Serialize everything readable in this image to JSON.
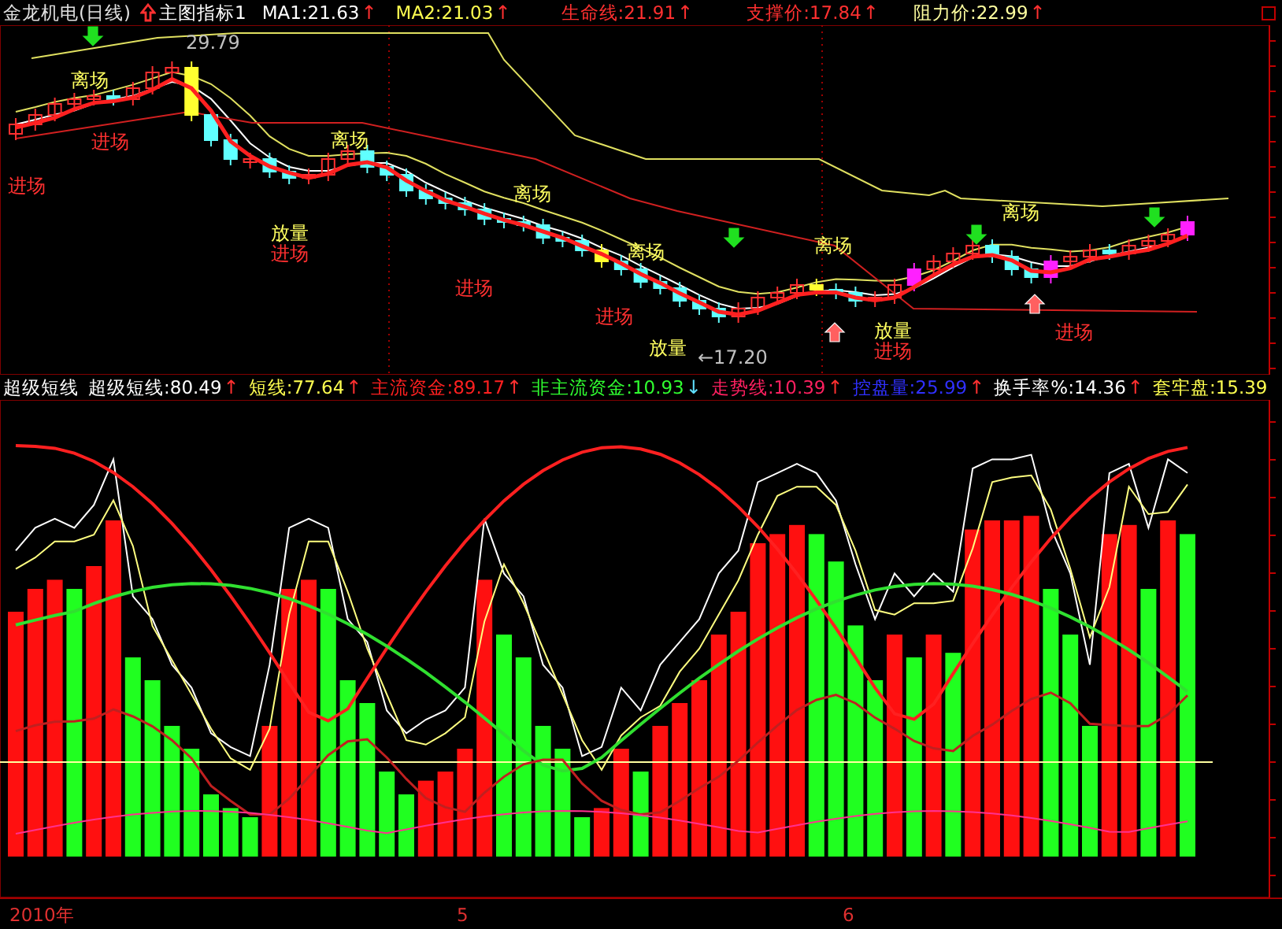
{
  "title_bar": {
    "stock": "金龙机电(日线)",
    "indicator": "主图指标1",
    "readings": [
      {
        "label": "MA1:21.63",
        "arrow": "↑",
        "color": "#ffffff",
        "rising": true
      },
      {
        "label": "MA2:21.03",
        "arrow": "↑",
        "color": "#ffff50",
        "rising": true
      },
      {
        "label": "生命线:21.91",
        "arrow": "↑",
        "color": "#ff3030",
        "rising": true
      },
      {
        "label": "支撑价:17.84",
        "arrow": "↑",
        "color": "#ff3030",
        "rising": true
      },
      {
        "label": "阻力价:22.99",
        "arrow": "↑",
        "color": "#ffffa0",
        "rising": true
      }
    ]
  },
  "price_chart": {
    "labels": [
      {
        "kind": "exit",
        "text": "离场"
      },
      {
        "kind": "value",
        "text": "29.79"
      },
      {
        "kind": "entry",
        "text": "进场"
      },
      {
        "kind": "entry",
        "text": "进场"
      },
      {
        "kind": "exit",
        "text": "离场"
      },
      {
        "kind": "volume",
        "text": "放量"
      },
      {
        "kind": "entry",
        "text": "进场"
      },
      {
        "kind": "exit",
        "text": "离场"
      },
      {
        "kind": "entry",
        "text": "进场"
      },
      {
        "kind": "exit",
        "text": "离场"
      },
      {
        "kind": "entry",
        "text": "进场"
      },
      {
        "kind": "volume",
        "text": "放量"
      },
      {
        "kind": "value",
        "text": "←17.20"
      },
      {
        "kind": "exit",
        "text": "离场"
      },
      {
        "kind": "volume",
        "text": "放量"
      },
      {
        "kind": "entry",
        "text": "进场"
      },
      {
        "kind": "exit",
        "text": "离场"
      },
      {
        "kind": "entry",
        "text": "进场"
      }
    ]
  },
  "indicator_bar": {
    "name": "超级短线",
    "readings": [
      {
        "label": "超级短线:80.49",
        "arrow": "↑",
        "color": "#ffffff",
        "rising": true
      },
      {
        "label": "短线:77.64",
        "arrow": "↑",
        "color": "#ffff50",
        "rising": true
      },
      {
        "label": "主流资金:89.17",
        "arrow": "↑",
        "color": "#ff2020",
        "rising": true
      },
      {
        "label": "非主流资金:10.93",
        "arrow": "↓",
        "color": "#30ff30",
        "rising": false
      },
      {
        "label": "走势线:10.39",
        "arrow": "↑",
        "color": "#ff2060",
        "rising": true
      },
      {
        "label": "控盘量:25.99",
        "arrow": "↑",
        "color": "#3030ff",
        "rising": true
      },
      {
        "label": "换手率%:14.36",
        "arrow": "↑",
        "color": "#ffffff",
        "rising": true
      },
      {
        "label": "套牢盘:15.39",
        "color": "#ffff50"
      }
    ]
  },
  "time_axis": {
    "labels": [
      "2010年",
      "5",
      "6"
    ]
  }
}
